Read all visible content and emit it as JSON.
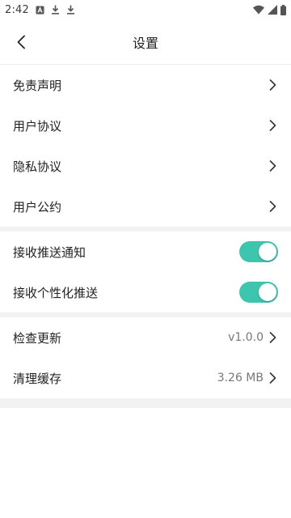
{
  "status_bar": {
    "time": "2:42",
    "icons": [
      "notification-a-icon",
      "download-icon",
      "download-icon",
      "wifi-icon",
      "signal-icon",
      "battery-icon"
    ]
  },
  "header": {
    "title": "设置",
    "back_icon": "back-arrow-icon"
  },
  "sections": {
    "legal": [
      {
        "label": "免责声明"
      },
      {
        "label": "用户协议"
      },
      {
        "label": "隐私协议"
      },
      {
        "label": "用户公约"
      }
    ],
    "notifications": [
      {
        "label": "接收推送通知",
        "enabled": true
      },
      {
        "label": "接收个性化推送",
        "enabled": true
      }
    ],
    "system": [
      {
        "label": "检查更新",
        "value": "v1.0.0"
      },
      {
        "label": "清理缓存",
        "value": "3.26 MB"
      }
    ]
  },
  "colors": {
    "toggle_on": "#3ec5ad",
    "divider": "#f2f2f2"
  }
}
